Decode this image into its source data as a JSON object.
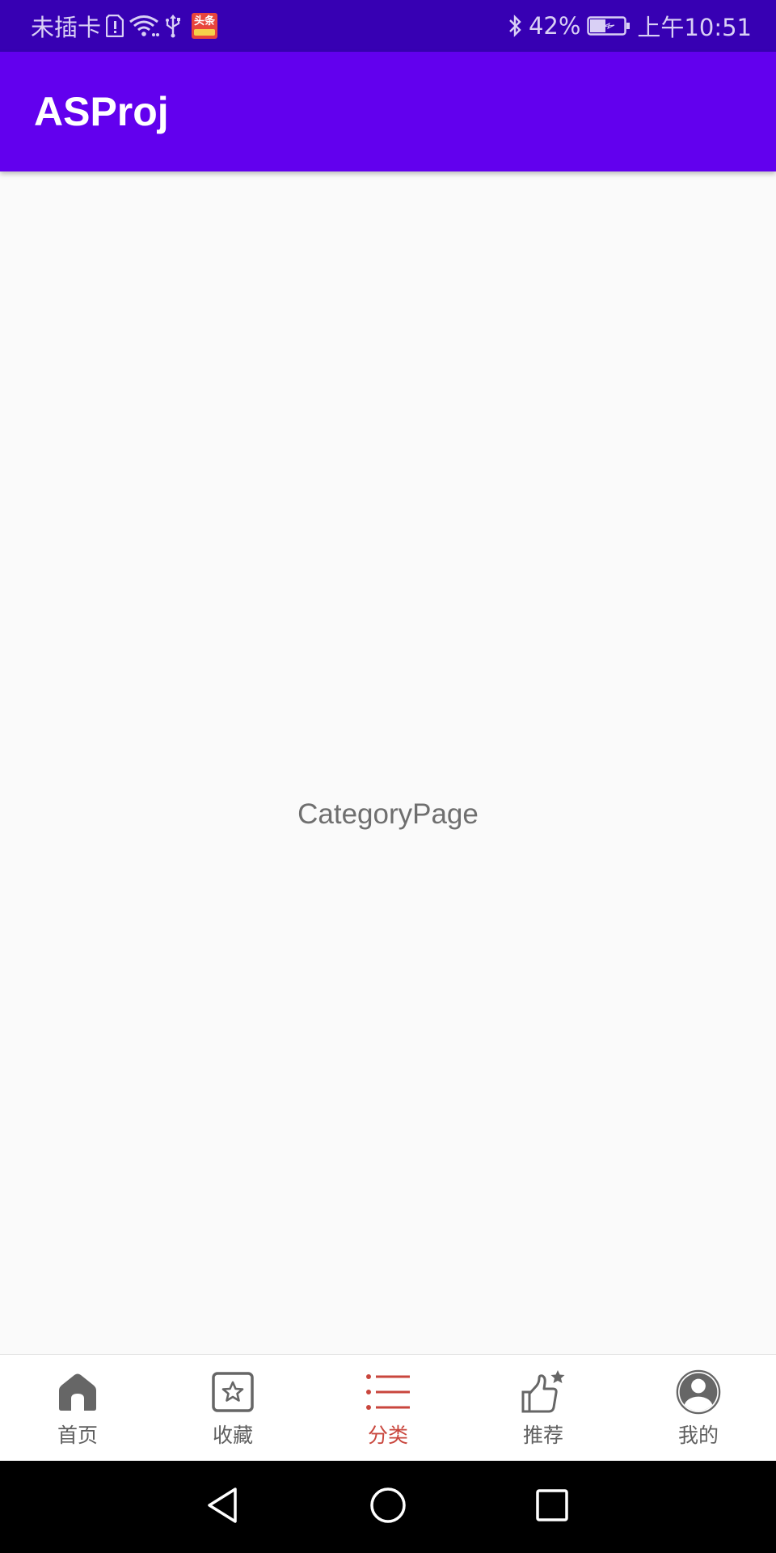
{
  "status_bar": {
    "carrier": "未插卡",
    "app_badge_text": "头条",
    "battery": "42%",
    "time": "上午10:51"
  },
  "app_bar": {
    "title": "ASProj"
  },
  "content": {
    "label": "CategoryPage"
  },
  "bottom_nav": {
    "active_index": 2,
    "accent_color": "#c9463d",
    "items": [
      {
        "label": "首页",
        "icon": "home-icon"
      },
      {
        "label": "收藏",
        "icon": "star-box-icon"
      },
      {
        "label": "分类",
        "icon": "list-icon"
      },
      {
        "label": "推荐",
        "icon": "thumbs-up-star-icon"
      },
      {
        "label": "我的",
        "icon": "profile-icon"
      }
    ]
  },
  "colors": {
    "status_bar": "#3700b3",
    "app_bar": "#6200ee",
    "background": "#fafafa"
  }
}
